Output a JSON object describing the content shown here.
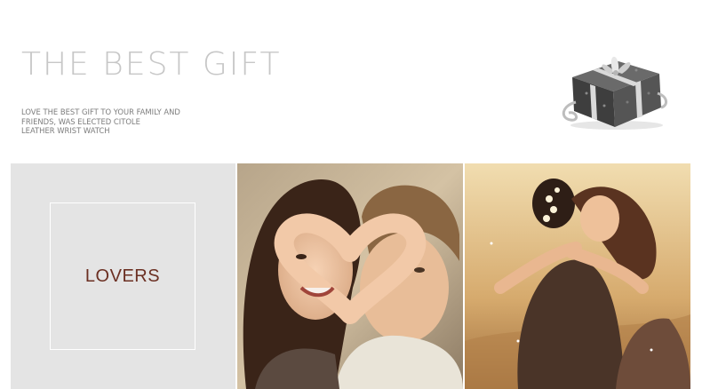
{
  "header": {
    "title": "THE BEST GIFT",
    "subtitle_lines": [
      "LOVE THE BEST GIFT TO YOUR FAMILY AND",
      "FRIENDS, WAS ELECTED CITOLE",
      "LEATHER WRIST WATCH"
    ]
  },
  "gift_image": {
    "icon": "gift-box-icon"
  },
  "panel": {
    "label": "LOVERS",
    "label_color": "#6b2f22",
    "background": "#e4e4e4"
  },
  "photos": [
    {
      "icon": "couple-heart-hands-photo"
    },
    {
      "icon": "couple-embrace-photo"
    }
  ]
}
